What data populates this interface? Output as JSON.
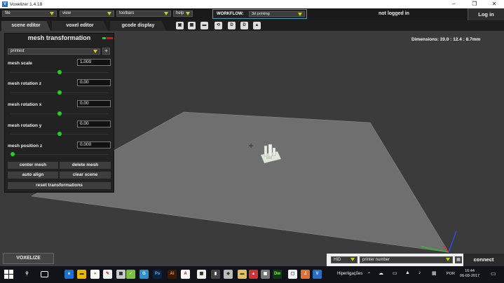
{
  "window": {
    "title": "Voxelizer 1.4.18",
    "logo": "V"
  },
  "menubar": {
    "menus": [
      "file",
      "view",
      "toolbars",
      "help"
    ],
    "workflow_label": "WORKFLOW:",
    "workflow_value": "3d printing",
    "login_status": "not logged in",
    "login_button": "Log in"
  },
  "tabs": [
    "scene editor",
    "voxel editor",
    "gcode display"
  ],
  "toolbar_icons": [
    "view-cube-icon",
    "grid-pattern-icon",
    "folder-icon",
    "rotate-view-icon",
    "layers-d1-icon",
    "layers-d2-icon",
    "triangle-mesh-icon"
  ],
  "dimensions": "Dimensions: 20.0 : 12.4 : 8.7mm",
  "panel": {
    "title": "mesh transformation",
    "preset": "printest",
    "add_label": "+",
    "fields": [
      {
        "label": "mesh scale",
        "value": "1.000",
        "slider": 0.5
      },
      {
        "label": "mesh rotation z",
        "value": "0.00",
        "slider": 0.5
      },
      {
        "label": "mesh rotation x",
        "value": "0.00",
        "slider": 0.5
      },
      {
        "label": "mesh rotation y",
        "value": "0.00",
        "slider": 0.5
      },
      {
        "label": "mesh position z",
        "value": "0.000",
        "slider": 0.02
      }
    ],
    "buttons": {
      "center_mesh": "center mesh",
      "delete_mesh": "delete mesh",
      "auto_align": "auto align",
      "clear_scene": "clear scene",
      "reset": "reset transformations"
    }
  },
  "bottom": {
    "voxelize": "VOXELIZE",
    "port": "HID",
    "printer": "printer number",
    "connect": "connect"
  },
  "taskbar": {
    "hiper": "Hiperligações",
    "lang": "POR",
    "time": "16:44",
    "date": "06-03-2017"
  },
  "colors": {
    "accent_green": "#1fd21f",
    "workflow_border": "#4aa0b8",
    "dropdown_arrow": "#c8d400"
  }
}
